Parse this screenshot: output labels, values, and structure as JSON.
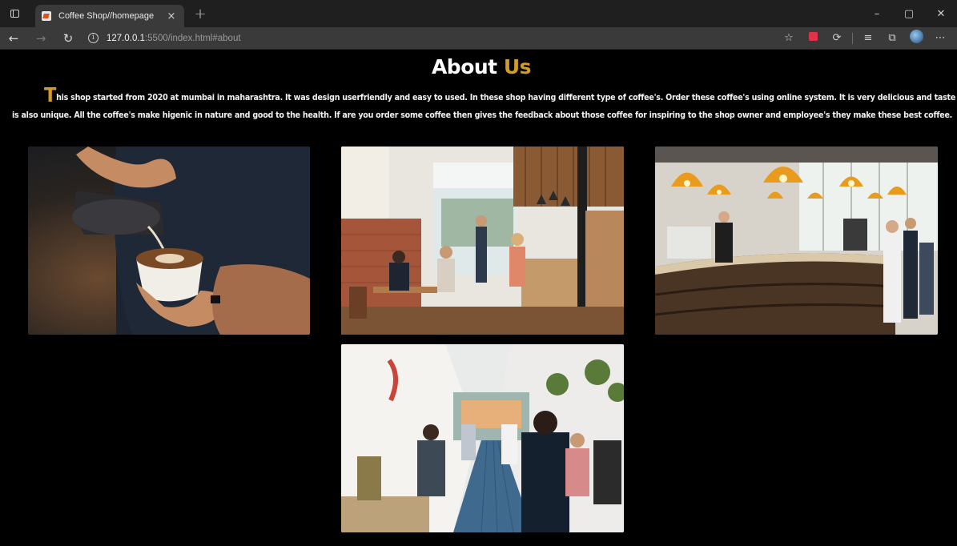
{
  "browser": {
    "tab": {
      "title": "Coffee Shop//homepage",
      "close": "×"
    },
    "new_tab": "+",
    "window": {
      "minimize": "–",
      "restore": "▢",
      "close": "✕"
    },
    "nav": {
      "back": "←",
      "forward": "→",
      "refresh": "↻"
    },
    "url": {
      "host": "127.0.0.1",
      "rest": ":5500/index.html#about"
    }
  },
  "about": {
    "title_main": "About",
    "title_accent": "Us",
    "drop_cap": "T",
    "text": "his shop started from 2020 at mumbai in maharashtra. It was design userfriendly and easy to used. In these shop having different type of coffee's. Order these coffee's using online system. It is very delicious and taste is also unique. All the coffee's make higenic in nature and good to the health. If are you order some coffee then gives the feedback about those coffee for inspiring to the shop owner and employee's they make these best coffee."
  },
  "colors": {
    "accent": "#d39c28",
    "background": "#000000",
    "chrome": "#3a3a3a"
  },
  "gallery": [
    "latte-art-photo",
    "cafe-interior-photo",
    "coffee-bar-counter-photo",
    "crowded-cafe-photo"
  ]
}
